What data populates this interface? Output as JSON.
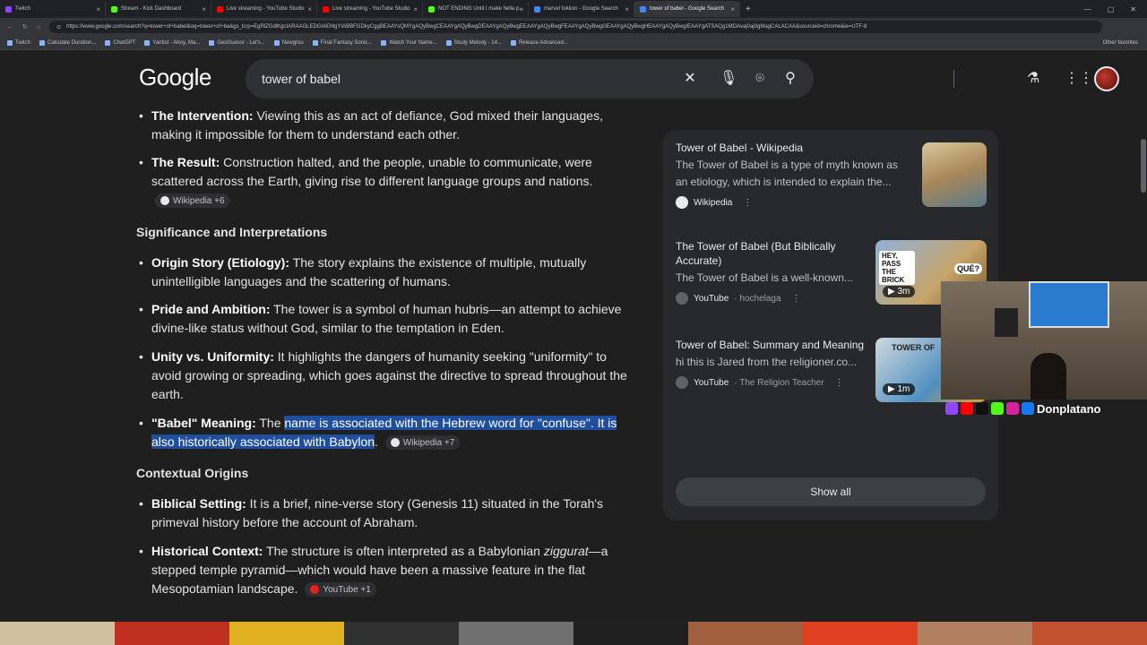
{
  "browser": {
    "tabs": [
      {
        "label": "Twitch",
        "color": "#9146ff"
      },
      {
        "label": "Stream - Kick Dashboard",
        "color": "#53fc18"
      },
      {
        "label": "Live streaming - YouTube Studio",
        "color": "#ff0000"
      },
      {
        "label": "Live streaming - YouTube Studio",
        "color": "#ff0000"
      },
      {
        "label": "NOT ENDING Until I make hella p...",
        "color": "#53fc18"
      },
      {
        "label": "marvel tokkon - Google Search",
        "color": "#4285f4"
      },
      {
        "label": "tower of babel - Google Search",
        "color": "#4285f4"
      }
    ],
    "new_tab": "+",
    "url": "https://www.google.com/search?q=tower+of+babel&oq=tower+of+ba&gs_lcrp=EgRlZGdlKgcIARAAGLEDGIAEMgYIABBFGDkyCggBEAAYsQMYgAQyBwgCEAAYgAQyBwgDEAAYgAQyBwgEEAAYgAQyBwgFEAAYgAQyBwgGEAAYgAQyBwgHEAAYgAQyBwgIEAAYgATSAQg1MDAxaj0aj0gMagCALACAA&sourceid=chrome&ie=UTF-8",
    "bookmarks": [
      "Twitch",
      "Calculate Duration...",
      "ChatGPT",
      "Yantist - Ahoy, Ma...",
      "GeoGuessr - Let's...",
      "Newgrou",
      "Final Fantasy Sonic...",
      "Watch Your Name...",
      "Study Melody - 14...",
      "Release Advanced..."
    ],
    "other_favorites": "Other favorites"
  },
  "header": {
    "logo": "Google",
    "query": "tower of babel",
    "icons": [
      "close-icon",
      "mic-icon",
      "lens-icon",
      "search-icon",
      "labs-icon",
      "apps-icon"
    ]
  },
  "main": {
    "b1_label": "The Intervention:",
    "b1_text": " Viewing this as an act of defiance, God mixed their languages, making it impossible for them to understand each other.",
    "b2_label": "The Result:",
    "b2_text": " Construction halted, and the people, unable to communicate, were scattered across the Earth, giving rise to different language groups and nations.",
    "b2_chip": "Wikipedia +6",
    "h1": "Significance and Interpretations",
    "b3_label": "Origin Story (Etiology):",
    "b3_text": " The story explains the existence of multiple, mutually unintelligible languages and the scattering of humans.",
    "b4_label": "Pride and Ambition:",
    "b4_text": " The tower is a symbol of human hubris—an attempt to achieve divine-like status without God, similar to the temptation in Eden.",
    "b5_label": "Unity vs. Uniformity:",
    "b5_text": " It highlights the dangers of humanity seeking \"uniformity\" to avoid growing or spreading, which goes against the directive to spread throughout the earth.",
    "b6_label": "\"Babel\" Meaning:",
    "b6_pre": " The ",
    "b6_hl": "name is associated with the Hebrew word for \"confuse\". It is also historically associated with Babylon",
    "b6_post": ".",
    "b6_chip": "Wikipedia +7",
    "h2": "Contextual Origins",
    "b7_label": "Biblical Setting:",
    "b7_text": " It is a brief, nine-verse story (Genesis 11) situated in the Torah's primeval history before the account of Abraham.",
    "b8_label": "Historical Context:",
    "b8_pre": " The structure is often interpreted as a Babylonian ",
    "b8_em": "ziggurat",
    "b8_post": "—a stepped temple pyramid—which would have been a massive feature in the flat Mesopotamian landscape.",
    "b8_chip": "YouTube +1"
  },
  "sources": {
    "cards": [
      {
        "title": "Tower of Babel - Wikipedia",
        "snippet": "The Tower of Babel is a type of myth known as an etiology, which is intended to explain the...",
        "source": "Wikipedia",
        "sub": ""
      },
      {
        "title": "The Tower of Babel (But Biblically Accurate)",
        "snippet": "The Tower of Babel is a well-known...",
        "source": "YouTube",
        "sub": "· hochelaga",
        "duration": "3m"
      },
      {
        "title": "Tower of Babel: Summary and Meaning",
        "snippet": "hi this is Jared from the religioner.co...",
        "source": "YouTube",
        "sub": "· The Religion Teacher",
        "duration": "1m"
      }
    ],
    "show_all": "Show all",
    "thumb2_text1": "HEY, PASS THE BRICK",
    "thumb2_text2": "QUÉ?",
    "thumb3_text": "TOWER OF"
  },
  "overlay": {
    "streamer_name": "Donplatano"
  }
}
